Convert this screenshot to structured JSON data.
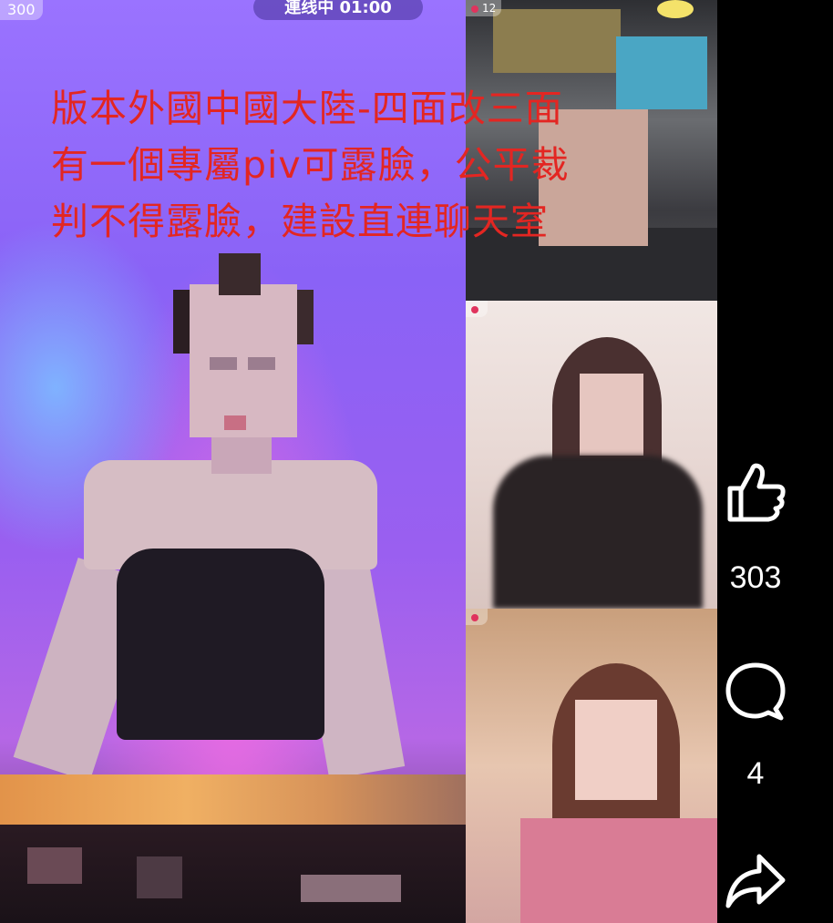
{
  "main_video": {
    "viewer_badge": "300",
    "status_pill": "連线中 01:00"
  },
  "side_videos": [
    {
      "badge": "12"
    },
    {
      "badge": ""
    },
    {
      "badge": ""
    }
  ],
  "caption": {
    "lines": [
      "版本外國中國大陸-四面改三面",
      "有一個專屬piv可露臉，公平裁",
      "判不得露臉，建設直連聊天室"
    ]
  },
  "actions": {
    "like_icon": "thumbs-up-icon",
    "like_count": "303",
    "comment_icon": "comment-bubble-icon",
    "comment_count": "4",
    "share_icon": "share-arrow-icon"
  },
  "colors": {
    "caption_text": "#e32622",
    "accent_pink": "#e0335d",
    "icon_white": "#ffffff"
  }
}
